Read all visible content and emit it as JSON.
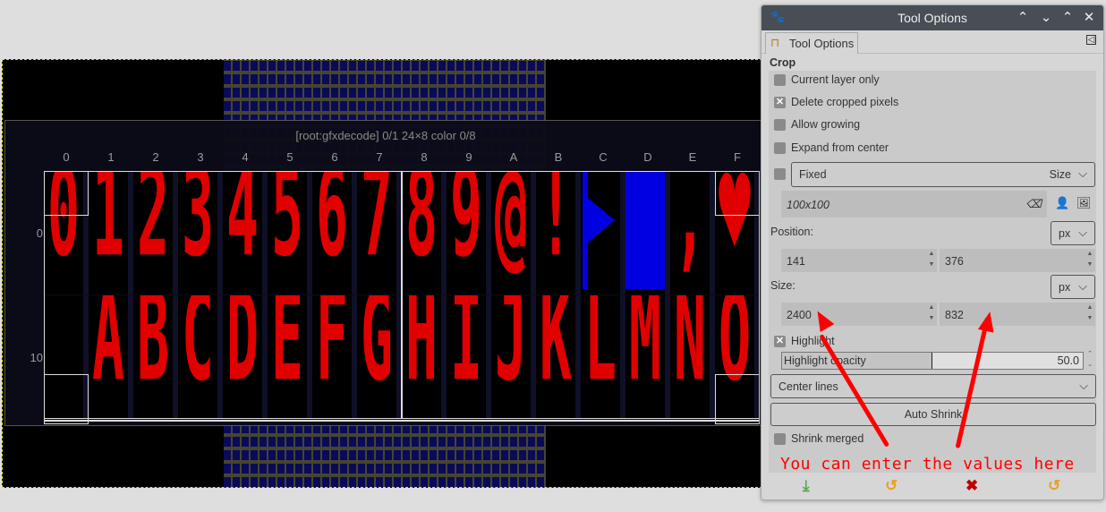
{
  "viewer": {
    "title": "[root:gfxdecode] 0/1 24×8 color 0/8",
    "columns": [
      "0",
      "1",
      "2",
      "3",
      "4",
      "5",
      "6",
      "7",
      "8",
      "9",
      "A",
      "B",
      "C",
      "D",
      "E",
      "F"
    ],
    "rows": [
      {
        "label": "0",
        "glyphs": [
          "0",
          "1",
          "2",
          "3",
          "4",
          "5",
          "6",
          "7",
          "8",
          "9",
          "@",
          "!",
          "",
          "",
          ",",
          "♥"
        ]
      },
      {
        "label": "10",
        "glyphs": [
          "",
          "A",
          "B",
          "C",
          "D",
          "E",
          "F",
          "G",
          "H",
          "I",
          "J",
          "K",
          "L",
          "M",
          "N",
          "O"
        ]
      }
    ]
  },
  "panel": {
    "title": "Tool Options",
    "tab": "Tool Options",
    "section": "Crop",
    "current_layer_only": {
      "label": "Current layer only",
      "checked": false
    },
    "delete_cropped": {
      "label": "Delete cropped pixels",
      "checked": true
    },
    "allow_growing": {
      "label": "Allow growing",
      "checked": false
    },
    "expand_center": {
      "label": "Expand from center",
      "checked": false
    },
    "fixed": {
      "label": "Fixed",
      "mode": "Size",
      "value": "100x100"
    },
    "position": {
      "label": "Position:",
      "unit": "px",
      "x": "141",
      "y": "376"
    },
    "size": {
      "label": "Size:",
      "unit": "px",
      "w": "2400",
      "h": "832"
    },
    "highlight": {
      "label": "Highlight",
      "checked": true
    },
    "highlight_opacity": {
      "label": "Highlight opacity",
      "value": "50.0",
      "fraction": 0.5
    },
    "guides": "Center lines",
    "auto_shrink": "Auto Shrink",
    "shrink_merged": {
      "label": "Shrink merged",
      "checked": false
    }
  },
  "annotation": "You can enter the values here",
  "colors": {
    "accent": "#ff0000",
    "glyph": "#e00000",
    "blue": "#0000e0"
  }
}
